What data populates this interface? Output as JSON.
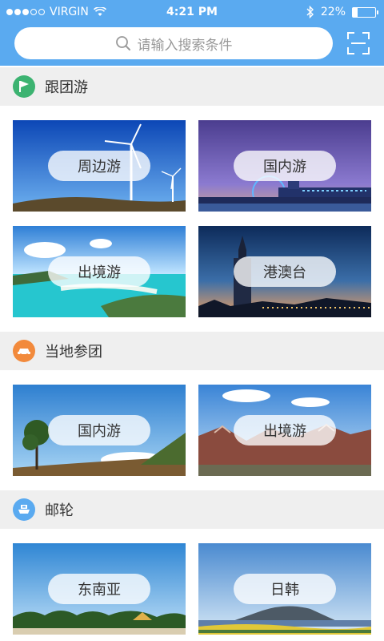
{
  "status_bar": {
    "carrier": "VIRGIN",
    "time": "4:21 PM",
    "battery": "22%",
    "battery_level": 0.22
  },
  "search": {
    "placeholder": "请输入搜索条件"
  },
  "sections": [
    {
      "title": "跟团游",
      "icon": "flag-icon",
      "color": "#3cb371",
      "cards": [
        {
          "label": "周边游",
          "image": "wind-turbines"
        },
        {
          "label": "国内游",
          "image": "city-ferris-wheel-night"
        },
        {
          "label": "出境游",
          "image": "tropical-lagoon"
        },
        {
          "label": "港澳台",
          "image": "taipei-skyline-dusk"
        }
      ]
    },
    {
      "title": "当地参团",
      "icon": "car-icon",
      "color": "#f28a3c",
      "cards": [
        {
          "label": "国内游",
          "image": "savanna-tree"
        },
        {
          "label": "出境游",
          "image": "red-rock-mountains"
        }
      ]
    },
    {
      "title": "邮轮",
      "icon": "ship-icon",
      "color": "#5aaaf0",
      "cards": [
        {
          "label": "东南亚",
          "image": "palm-beach"
        },
        {
          "label": "日韩",
          "image": "volcanic-island"
        }
      ]
    }
  ]
}
